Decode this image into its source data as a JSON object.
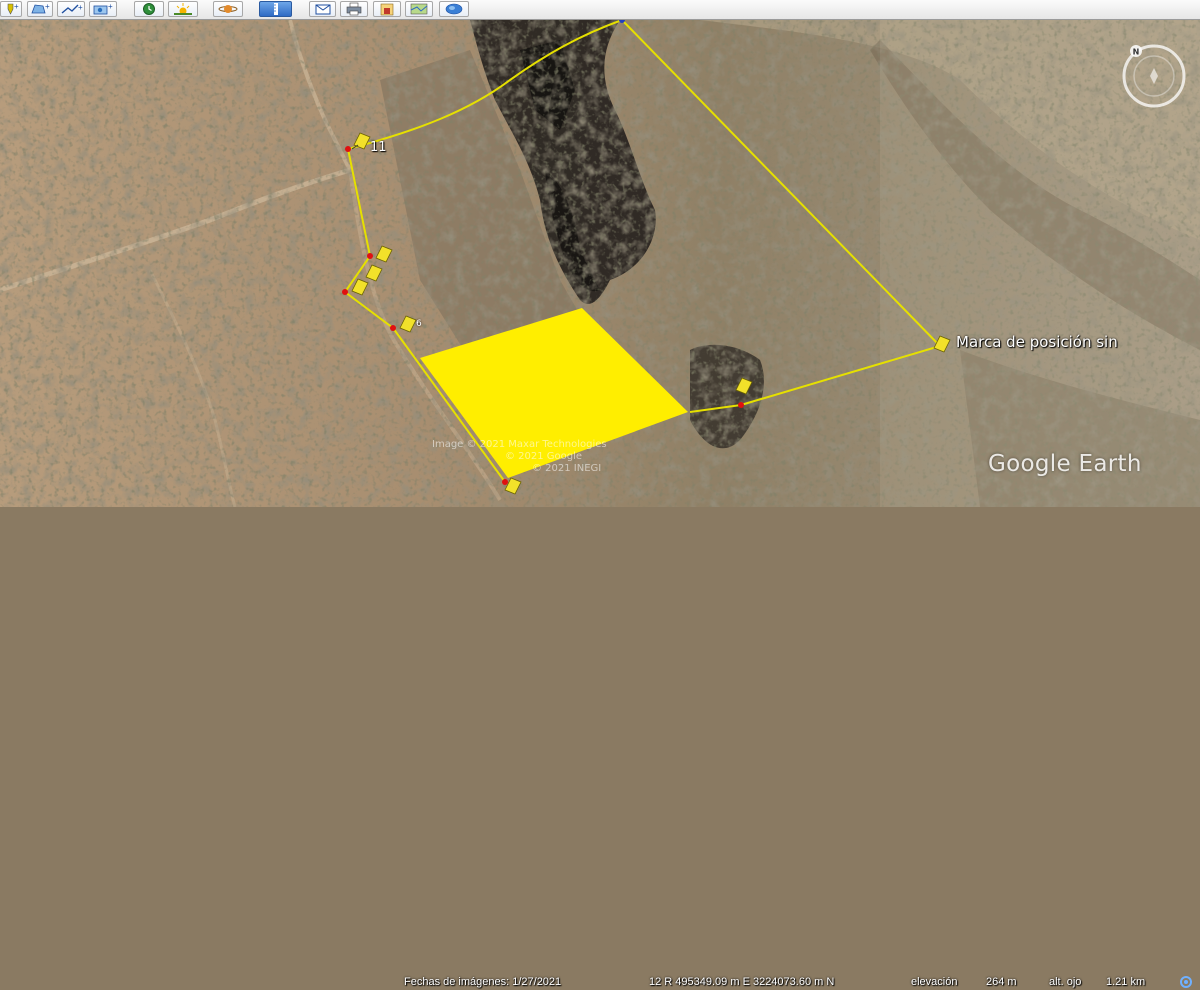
{
  "toolbar": {
    "buttons": [
      {
        "name": "add-placemark-button",
        "icon": "placemark-plus-icon"
      },
      {
        "name": "add-polygon-button",
        "icon": "polygon-plus-icon"
      },
      {
        "name": "add-path-button",
        "icon": "path-plus-icon"
      },
      {
        "name": "add-overlay-button",
        "icon": "overlay-plus-icon"
      },
      {
        "name": "record-tour-button",
        "icon": "record-tour-icon"
      },
      {
        "name": "historical-imagery-button",
        "icon": "clock-icon"
      },
      {
        "name": "sunlight-button",
        "icon": "sun-icon"
      },
      {
        "name": "planets-button",
        "icon": "planet-icon"
      },
      {
        "name": "ruler-button",
        "icon": "ruler-icon"
      },
      {
        "name": "email-button",
        "icon": "mail-icon"
      },
      {
        "name": "print-button",
        "icon": "printer-icon"
      },
      {
        "name": "save-image-button",
        "icon": "save-image-icon"
      },
      {
        "name": "view-in-maps-button",
        "icon": "map-icon"
      },
      {
        "name": "earth-gallery-button",
        "icon": "globe-icon"
      }
    ]
  },
  "map": {
    "placemark_label": "Marca de posición sin",
    "pin11_label": "11",
    "pin6_label": "6",
    "attribution": {
      "line1": "Image © 2021 Maxar Technologies",
      "line2": "© 2021 Google",
      "line3": "© 2021 INEGI"
    },
    "logo": "Google Earth",
    "colors": {
      "path": "#e6e000",
      "polygon_fill": "#ffee00",
      "pin_dot": "#e01010"
    }
  },
  "status": {
    "imagery_date_label": "Fechas de imágenes: 1/27/2021",
    "coordinates": "12 R 495349.09 m E 3224073.60 m N",
    "elevation_label": "elevación",
    "elevation_value": "264 m",
    "eye_alt_label": "alt. ojo",
    "eye_alt_value": "1.21 km"
  },
  "compass": {
    "north_label": "N"
  }
}
